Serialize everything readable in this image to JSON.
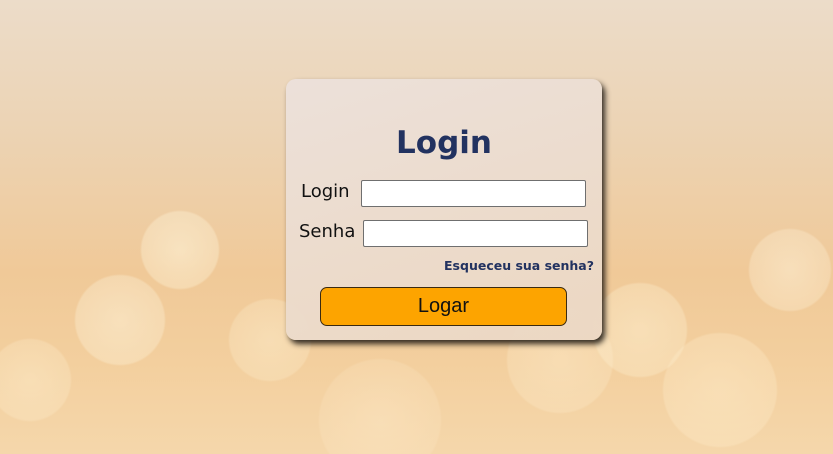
{
  "login_form": {
    "title": "Login",
    "fields": {
      "login": {
        "label": "Login",
        "value": "",
        "placeholder": ""
      },
      "senha": {
        "label": "Senha",
        "value": "",
        "placeholder": ""
      }
    },
    "forgot_password_link": "Esqueceu sua senha?",
    "submit_label": "Logar"
  },
  "colors": {
    "title_text": "#223260",
    "link_text": "#223260",
    "button_background": "#fda400",
    "background_tone": "#f0c998"
  }
}
